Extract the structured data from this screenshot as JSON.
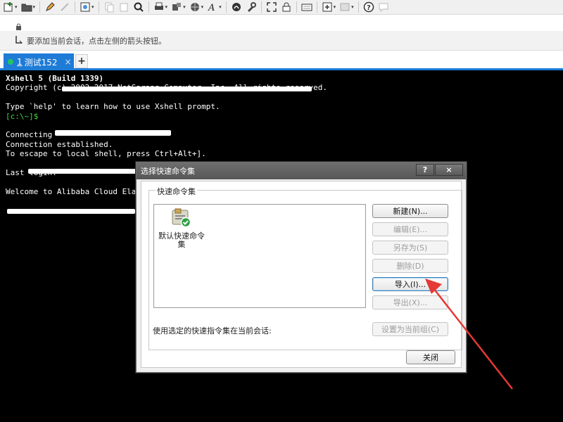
{
  "toolbar": {
    "icons": [
      "new-session-icon",
      "open-folder-icon",
      "edit-icon",
      "link-icon",
      "properties-icon",
      "copy-icon",
      "paste-icon",
      "find-icon",
      "print-icon",
      "transfer-icon",
      "globe-icon",
      "font-icon",
      "xftp-icon",
      "tools-icon",
      "fullscreen-icon",
      "lock-icon",
      "keyboard-icon",
      "add-icon",
      "layout-icon",
      "help-icon",
      "chat-icon"
    ]
  },
  "hint": {
    "text": "要添加当前会话，点击左侧的箭头按钮。"
  },
  "tabs": [
    {
      "number": "1",
      "label": "测试152",
      "close": "×"
    }
  ],
  "tab_add_label": "+",
  "terminal": {
    "lines": [
      {
        "text": "Xshell 5 (Build 1339)",
        "style": "bold"
      },
      {
        "text": "Copyright (c) 2002-2017 NetSarang Computer, Inc. All rights reserved.",
        "style": "normal"
      },
      {
        "text": "",
        "style": "normal"
      },
      {
        "text": "Type `help' to learn how to use Xshell prompt.",
        "style": "normal"
      },
      {
        "text": "[c:\\~]$",
        "style": "green"
      },
      {
        "text": "",
        "style": "normal"
      },
      {
        "text": "Connecting",
        "style": "normal"
      },
      {
        "text": "Connection established.",
        "style": "normal"
      },
      {
        "text": "To escape to local shell, press Ctrl+Alt+].",
        "style": "normal"
      },
      {
        "text": "",
        "style": "normal"
      },
      {
        "text": "Last login:",
        "style": "normal"
      },
      {
        "text": "",
        "style": "normal"
      },
      {
        "text": "Welcome to Alibaba Cloud Elastic Compute Service !",
        "style": "normal"
      }
    ]
  },
  "dialog": {
    "title": "选择快速命令集",
    "help_label": "?",
    "close_label": "×",
    "group_title": "快速命令集",
    "list_items": [
      {
        "label": "默认快速命令集"
      }
    ],
    "buttons": {
      "new": "新建(N)...",
      "edit": "编辑(E)...",
      "save_as": "另存为(S)",
      "delete": "删除(D)",
      "import": "导入(I)...",
      "export": "导出(X)...",
      "set_default": "设置为当前组(C)",
      "close": "关闭"
    },
    "use_label": "使用选定的快速指令集在当前会话:"
  },
  "colors": {
    "accent": "#1e7bd6",
    "terminal_bg": "#000000",
    "prompt_green": "#3ddc3d",
    "annotation_arrow": "#e53935"
  }
}
